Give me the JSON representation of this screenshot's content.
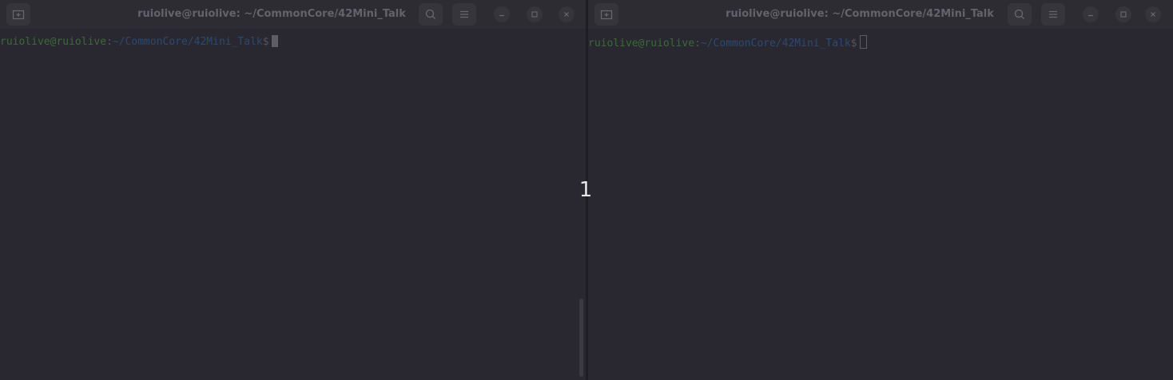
{
  "colors": {
    "background": "#29272f",
    "titlebar": "#2e2c33",
    "prompt_user": "#3c6a3a",
    "prompt_path": "#2d4a72",
    "text_dim": "#55535b"
  },
  "windows": [
    {
      "title": "ruiolive@ruiolive: ~/CommonCore/42Mini_Talk",
      "prompt": {
        "user_host": "ruiolive@ruiolive",
        "colon": ":",
        "path": "~/CommonCore/42Mini_Talk",
        "dollar": "$"
      },
      "cursor_style": "block-filled"
    },
    {
      "title": "ruiolive@ruiolive: ~/CommonCore/42Mini_Talk",
      "prompt": {
        "user_host": "ruiolive@ruiolive",
        "colon": ":",
        "path": "~/CommonCore/42Mini_Talk",
        "dollar": "$"
      },
      "cursor_style": "block-outline"
    }
  ],
  "overlay": {
    "counter": "1"
  },
  "icons": {
    "new_tab": "new-tab-icon",
    "search": "search-icon",
    "menu": "hamburger-menu-icon",
    "minimize": "minimize-icon",
    "maximize": "maximize-icon",
    "close": "close-icon"
  }
}
